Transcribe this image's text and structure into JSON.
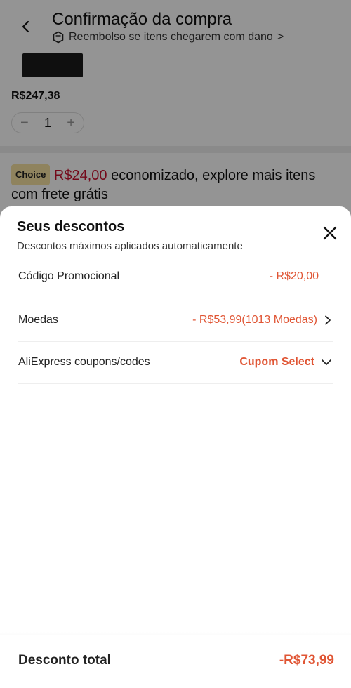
{
  "header": {
    "title": "Confirmação da compra",
    "refund_text": "Reembolso se itens chegarem com dano",
    "refund_chevron": ">"
  },
  "product": {
    "price": "R$247,38",
    "quantity": "1",
    "minus": "−",
    "plus": "+"
  },
  "choice": {
    "badge": "Choice",
    "amount": "R$24,00",
    "text": "economizado, explore mais itens com frete grátis"
  },
  "sheet": {
    "title": "Seus descontos",
    "subtitle": "Descontos máximos aplicados automaticamente",
    "rows": [
      {
        "label": "Código Promocional",
        "value": "- R$20,00"
      },
      {
        "label": "Moedas",
        "value": "- R$53,99(1013 Moedas)"
      },
      {
        "label": "AliExpress coupons/codes",
        "value": "Cupom Select"
      }
    ],
    "total_label": "Desconto total",
    "total_value": "-R$73,99"
  },
  "colors": {
    "accent": "#e05534",
    "choice_red": "#c8102e",
    "overlay": "rgba(0,0,0,0.42)"
  },
  "icons": {
    "back": "chevron-left-icon",
    "shield": "box-shield-icon",
    "close": "close-icon",
    "chevron_right": "chevron-right-icon",
    "chevron_down": "chevron-down-icon"
  }
}
